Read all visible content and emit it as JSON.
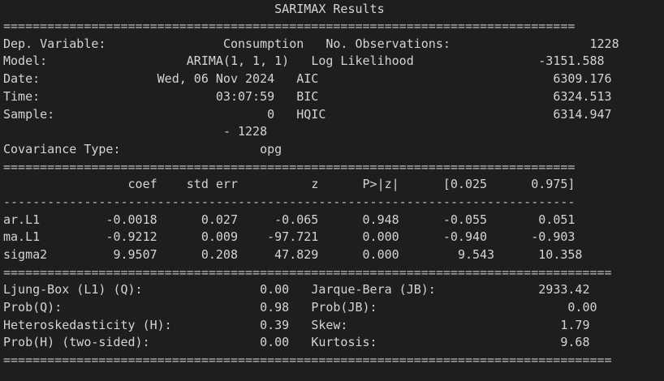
{
  "title": "SARIMAX Results",
  "rules": {
    "double_short": "==============================================================================",
    "dash_short": "------------------------------------------------------------------------------",
    "double_long": "==================================================================================="
  },
  "model_info": {
    "dep_variable": {
      "label": "Dep. Variable:",
      "value": "Consumption"
    },
    "model": {
      "label": "Model:",
      "value": "ARIMA(1, 1, 1)"
    },
    "date": {
      "label": "Date:",
      "value": "Wed, 06 Nov 2024"
    },
    "time": {
      "label": "Time:",
      "value": "03:07:59"
    },
    "sample": {
      "label": "Sample:",
      "value": "0",
      "value2": "- 1228"
    },
    "covariance_type": {
      "label": "Covariance Type:",
      "value": "opg"
    },
    "no_observations": {
      "label": "No. Observations:",
      "value": "1228"
    },
    "log_likelihood": {
      "label": "Log Likelihood",
      "value": "-3151.588"
    },
    "aic": {
      "label": "AIC",
      "value": "6309.176"
    },
    "bic": {
      "label": "BIC",
      "value": "6324.513"
    },
    "hqic": {
      "label": "HQIC",
      "value": "6314.947"
    }
  },
  "coef_table": {
    "headers": [
      "coef",
      "std err",
      "z",
      "P>|z|",
      "[0.025",
      "0.975]"
    ],
    "rows": [
      {
        "name": "ar.L1",
        "values": [
          "-0.0018",
          "0.027",
          "-0.065",
          "0.948",
          "-0.055",
          "0.051"
        ]
      },
      {
        "name": "ma.L1",
        "values": [
          "-0.9212",
          "0.009",
          "-97.721",
          "0.000",
          "-0.940",
          "-0.903"
        ]
      },
      {
        "name": "sigma2",
        "values": [
          "9.9507",
          "0.208",
          "47.829",
          "0.000",
          "9.543",
          "10.358"
        ]
      }
    ]
  },
  "diagnostics": [
    {
      "left_label": "Ljung-Box (L1) (Q):",
      "left_value": "0.00",
      "right_label": "Jarque-Bera (JB):",
      "right_value": "2933.42"
    },
    {
      "left_label": "Prob(Q):",
      "left_value": "0.98",
      "right_label": "Prob(JB):",
      "right_value": "0.00"
    },
    {
      "left_label": "Heteroskedasticity (H):",
      "left_value": "0.39",
      "right_label": "Skew:",
      "right_value": "1.79"
    },
    {
      "left_label": "Prob(H) (two-sided):",
      "left_value": "0.00",
      "right_label": "Kurtosis:",
      "right_value": "9.68"
    }
  ]
}
